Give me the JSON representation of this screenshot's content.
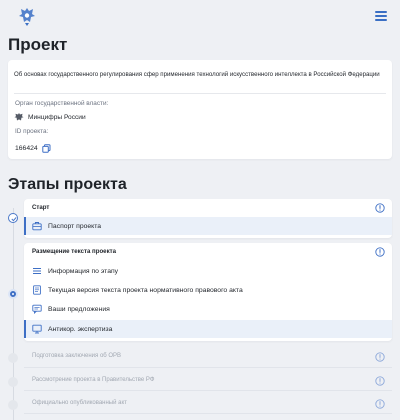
{
  "header": {
    "logo_icon": "coat-of-arms-icon",
    "menu_icon": "hamburger-menu-icon"
  },
  "page_title": "Проект",
  "project": {
    "description": "Об основах государственного регулирования сфер применения технологий искусственного интеллекта в Российской Федерации",
    "authority_label": "Орган государственной власти:",
    "authority_name": "Минцифры России",
    "id_label": "ID проекта:",
    "id_value": "166424",
    "copy_icon": "copy-icon"
  },
  "stages_title": "Этапы проекта",
  "stages": [
    {
      "title": "Старт",
      "status": "done",
      "items": [
        {
          "label": "Паспорт проекта",
          "icon": "briefcase-icon",
          "selected": true
        }
      ]
    },
    {
      "title": "Размещение текста проекта",
      "status": "active",
      "items": [
        {
          "label": "Информация по этапу",
          "icon": "list-icon",
          "selected": false
        },
        {
          "label": "Текущая версия текста проекта нормативного правового акта",
          "icon": "document-icon",
          "selected": false
        },
        {
          "label": "Ваши предложения",
          "icon": "chat-icon",
          "selected": false
        },
        {
          "label": "Антикор. экспертиза",
          "icon": "monitor-icon",
          "selected": true
        }
      ]
    },
    {
      "title": "Подготовка заключения об ОРВ",
      "status": "pending"
    },
    {
      "title": "Рассмотрение проекта в Правительстве РФ",
      "status": "pending"
    },
    {
      "title": "Официально опубликованный акт",
      "status": "pending"
    }
  ],
  "colors": {
    "accent": "#3e6fc5",
    "page_bg": "#eef0f4",
    "selected_bg": "#eaf0f9",
    "muted_text": "#a2a8b2"
  }
}
